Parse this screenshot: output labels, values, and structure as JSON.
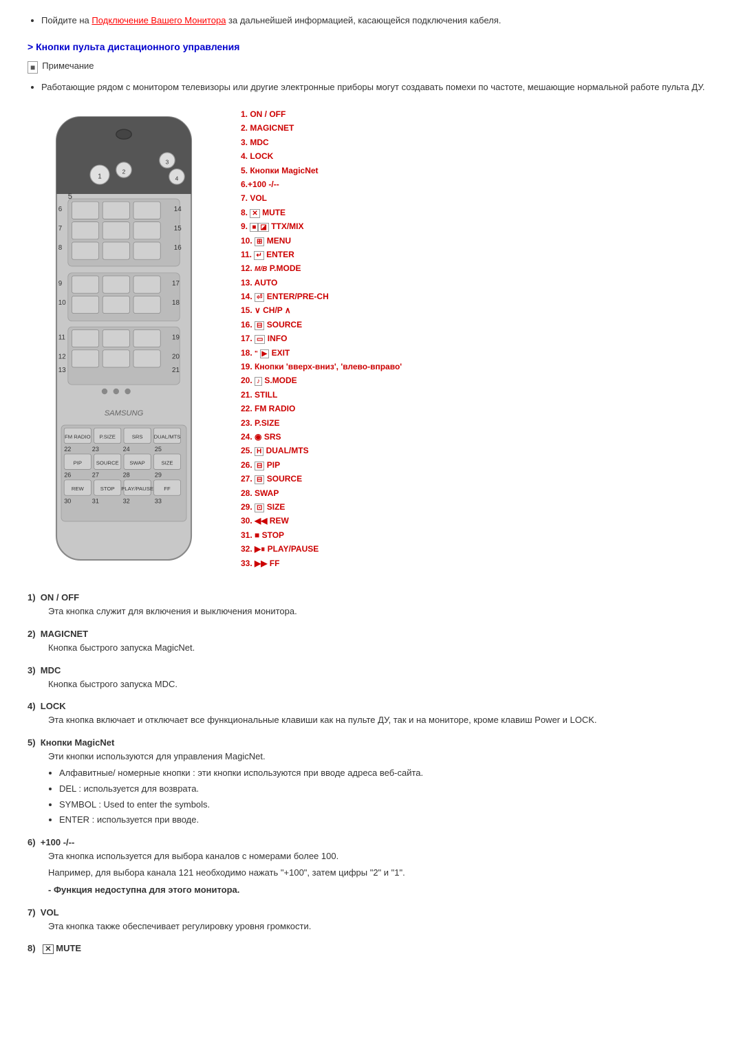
{
  "intro": {
    "bullet_text": "Пойдите на",
    "link_text": "Подключение Вашего Монитора",
    "link_after": " за дальнейшей информацией, касающейся подключения кабеля."
  },
  "section_heading": "Кнопки пульта дистационного управления",
  "note_label": "Примечание",
  "note_bullet": "Работающие рядом с монитором телевизоры или другие электронные приборы могут создавать помехи по частоте, мешающие нормальной работе пульта ДУ.",
  "legend": [
    {
      "num": "1.",
      "label": " ON / OFF",
      "red": true
    },
    {
      "num": "2.",
      "label": " MAGICNET",
      "red": true
    },
    {
      "num": "3.",
      "label": " MDC",
      "red": true
    },
    {
      "num": "4.",
      "label": " LOCK",
      "red": true
    },
    {
      "num": "5.",
      "label": " Кнопки MagicNet",
      "red": true
    },
    {
      "num": "6.",
      "label": "+100 -/--",
      "red": true
    },
    {
      "num": "7.",
      "label": " VOL",
      "red": true
    },
    {
      "num": "8.",
      "label": "  MUTE",
      "icon": "mute",
      "red": true
    },
    {
      "num": "9.",
      "label": "  TTX/MIX",
      "icon": "ttx",
      "red": true
    },
    {
      "num": "10.",
      "label": "  MENU",
      "icon": "menu",
      "red": true
    },
    {
      "num": "11.",
      "label": "  ENTER",
      "icon": "enter",
      "red": true
    },
    {
      "num": "12.",
      "label": " P.MODE",
      "icon": "mb",
      "red": true
    },
    {
      "num": "13.",
      "label": " AUTO",
      "red": true
    },
    {
      "num": "14.",
      "label": "  ENTER/PRE-CH",
      "icon": "enter2",
      "red": true
    },
    {
      "num": "15.",
      "label": " ∨ CH/P ∧",
      "red": true
    },
    {
      "num": "16.",
      "label": "  SOURCE",
      "icon": "source",
      "red": true
    },
    {
      "num": "17.",
      "label": "  INFO",
      "icon": "info",
      "red": true
    },
    {
      "num": "18.",
      "label": "  EXIT",
      "icon": "exit",
      "red": true
    },
    {
      "num": "19.",
      "label": " Кнопки 'вверх-вниз', 'влево-вправо'",
      "red": true
    },
    {
      "num": "20.",
      "label": "  S.MODE",
      "icon": "smode",
      "red": true
    },
    {
      "num": "21.",
      "label": " STILL",
      "red": true
    },
    {
      "num": "22.",
      "label": " FM RADIO",
      "red": true
    },
    {
      "num": "23.",
      "label": " P.SIZE",
      "red": true
    },
    {
      "num": "24.",
      "label": "  SRS",
      "icon": "srs",
      "red": true
    },
    {
      "num": "25.",
      "label": "  DUAL/MTS",
      "icon": "dual",
      "red": true
    },
    {
      "num": "26.",
      "label": "  PIP",
      "icon": "pip",
      "red": true
    },
    {
      "num": "27.",
      "label": "  SOURCE",
      "icon": "source2",
      "red": true
    },
    {
      "num": "28.",
      "label": " SWAP",
      "red": true
    },
    {
      "num": "29.",
      "label": "  SIZE",
      "icon": "size",
      "red": true
    },
    {
      "num": "30.",
      "label": "  REW",
      "icon": "rew",
      "red": true
    },
    {
      "num": "31.",
      "label": "  STOP",
      "icon": "stop",
      "red": true
    },
    {
      "num": "32.",
      "label": "  PLAY/PAUSE",
      "icon": "play",
      "red": true
    },
    {
      "num": "33.",
      "label": "  FF",
      "icon": "ff",
      "red": true
    }
  ],
  "descriptions": [
    {
      "num": "1)",
      "title": "ON / OFF",
      "body": "Эта кнопка служит для включения и выключения монитора."
    },
    {
      "num": "2)",
      "title": "MAGICNET",
      "body": "Кнопка быстрого запуска MagicNet."
    },
    {
      "num": "3)",
      "title": "MDC",
      "body": "Кнопка быстрого запуска MDC."
    },
    {
      "num": "4)",
      "title": "LOCK",
      "body": "Эта кнопка включает и отключает все функциональные клавиши как на пульте ДУ, так и на мониторе, кроме клавиш Power и LOCK."
    },
    {
      "num": "5)",
      "title": "Кнопки MagicNet",
      "body": "Эти кнопки используются для управления MagicNet.",
      "bullets": [
        "Алфавитные/ номерные кнопки : эти кнопки используются при вводе адреса веб-сайта.",
        "DEL : используется для возврата.",
        "SYMBOL : Used to enter the symbols.",
        "ENTER : используется при вводе."
      ]
    },
    {
      "num": "6)",
      "title": "+100 -/--",
      "body": "Эта кнопка используется для выбора каналов с номерами более 100.",
      "extra": "Например, для выбора канала 121 необходимо нажать \"+100\", затем цифры \"2\" и \"1\".",
      "extra_bold": "- Функция недоступна для этого монитора."
    },
    {
      "num": "7)",
      "title": "VOL",
      "body": "Эта кнопка также обеспечивает регулировку уровня громкости."
    },
    {
      "num": "8)",
      "title": "MUTE",
      "body": ""
    }
  ]
}
